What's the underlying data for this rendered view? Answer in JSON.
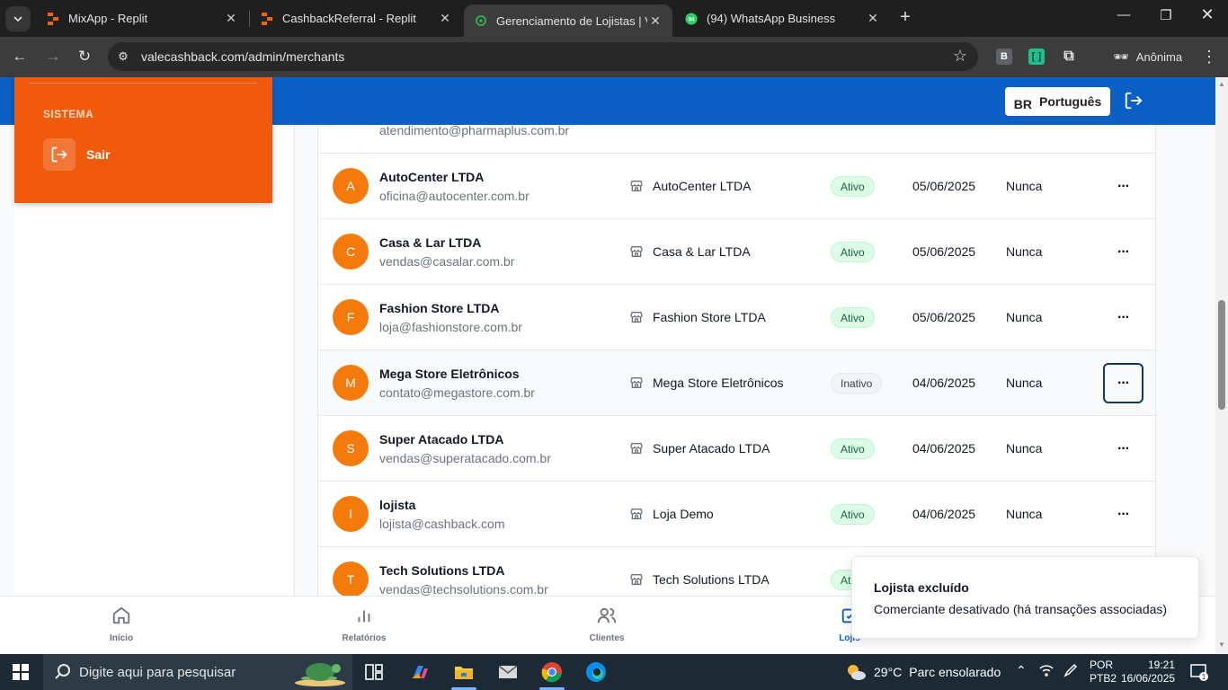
{
  "browser": {
    "tabs": [
      {
        "title": "MixApp - Replit",
        "icon": "replit-icon",
        "active": false
      },
      {
        "title": "CashbackReferral - Replit",
        "icon": "replit-icon",
        "active": false
      },
      {
        "title": "Gerenciamento de Lojistas | Vale",
        "icon": "site-icon",
        "active": true
      },
      {
        "title": "(94) WhatsApp Business",
        "icon": "whatsapp-icon",
        "active": false
      }
    ],
    "url": "valecashback.com/admin/merchants",
    "profile_label": "Anônima",
    "extension_b": "B",
    "whatsapp_badge": "94"
  },
  "header": {
    "flag": "BR",
    "language": "Português"
  },
  "sidebar": {
    "section_title": "SISTEMA",
    "exit_label": "Sair"
  },
  "partial_row": {
    "email": "atendimento@pharmaplus.com.br"
  },
  "merchants": [
    {
      "initial": "A",
      "name": "AutoCenter LTDA",
      "email": "oficina@autocenter.com.br",
      "store": "AutoCenter LTDA",
      "status": "Ativo",
      "active": true,
      "date": "05/06/2025",
      "last_access": "Nunca"
    },
    {
      "initial": "C",
      "name": "Casa & Lar LTDA",
      "email": "vendas@casalar.com.br",
      "store": "Casa & Lar LTDA",
      "status": "Ativo",
      "active": true,
      "date": "05/06/2025",
      "last_access": "Nunca"
    },
    {
      "initial": "F",
      "name": "Fashion Store LTDA",
      "email": "loja@fashionstore.com.br",
      "store": "Fashion Store LTDA",
      "status": "Ativo",
      "active": true,
      "date": "05/06/2025",
      "last_access": "Nunca"
    },
    {
      "initial": "M",
      "name": "Mega Store Eletrônicos",
      "email": "contato@megastore.com.br",
      "store": "Mega Store Eletrônicos",
      "status": "Inativo",
      "active": false,
      "date": "04/06/2025",
      "last_access": "Nunca"
    },
    {
      "initial": "S",
      "name": "Super Atacado LTDA",
      "email": "vendas@superatacado.com.br",
      "store": "Super Atacado LTDA",
      "status": "Ativo",
      "active": true,
      "date": "04/06/2025",
      "last_access": "Nunca"
    },
    {
      "initial": "l",
      "name": "lojista",
      "email": "lojista@cashback.com",
      "store": "Loja Demo",
      "status": "Ativo",
      "active": true,
      "date": "04/06/2025",
      "last_access": "Nunca"
    },
    {
      "initial": "T",
      "name": "Tech Solutions LTDA",
      "email": "vendas@techsolutions.com.br",
      "store": "Tech Solutions LTDA",
      "status": "Ati",
      "active": true,
      "date": "",
      "last_access": ""
    }
  ],
  "actions_label": "···",
  "bottom_nav": [
    {
      "label": "Início",
      "icon": "home-icon"
    },
    {
      "label": "Relatórios",
      "icon": "bar-chart-icon"
    },
    {
      "label": "Clientes",
      "icon": "users-icon"
    },
    {
      "label": "Lojis",
      "icon": "store-check-icon"
    }
  ],
  "toast": {
    "title": "Lojista excluído",
    "description": "Comerciante desativado (há transações associadas)"
  },
  "taskbar": {
    "search_placeholder": "Digite aqui para pesquisar",
    "weather_temp": "29°C",
    "weather_desc": "Parc ensolarado",
    "lang_line1": "POR",
    "lang_line2": "PTB2",
    "time": "19:21",
    "date": "16/06/2025",
    "notification_count": "1"
  },
  "colors": {
    "brand_blue": "#0b5fc5",
    "brand_orange": "#f05a0c",
    "avatar_orange": "#f47a0b"
  }
}
